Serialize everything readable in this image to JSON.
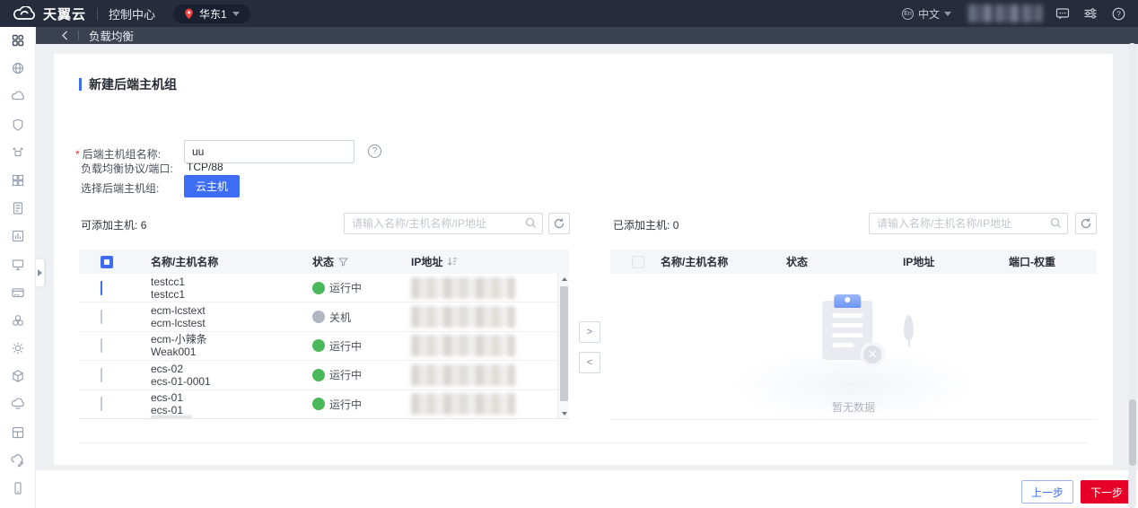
{
  "topbar": {
    "brand": "天翼云",
    "console": "控制中心",
    "region": "华东1",
    "language": "中文",
    "language_badge": "En"
  },
  "breadcrumb": {
    "title": "负载均衡"
  },
  "section": {
    "title": "新建后端主机组"
  },
  "form": {
    "protocol_label": "负载均衡协议/端口:",
    "protocol_value": "TCP/88",
    "required_mark": "*",
    "name_label": "后端主机组名称:",
    "name_value": "uu",
    "help_glyph": "?",
    "select_label": "选择后端主机组:",
    "host_type_button": "云主机"
  },
  "left_panel": {
    "count_label": "可添加主机:",
    "count": "6",
    "search_placeholder": "请输入名称/主机名称/IP地址",
    "columns": {
      "name": "名称/主机名称",
      "status": "状态",
      "ip": "IP地址"
    },
    "rows": [
      {
        "name": "testcc1",
        "host": "testcc1",
        "status": "运行中",
        "status_type": "running",
        "checked": true
      },
      {
        "name": "ecm-lcstext",
        "host": "ecm-lcstest",
        "status": "关机",
        "status_type": "stopped",
        "checked": false
      },
      {
        "name": "ecm-小辣条",
        "host": "Weak001",
        "status": "运行中",
        "status_type": "running",
        "checked": false
      },
      {
        "name": "ecs-02",
        "host": "ecs-01-0001",
        "status": "运行中",
        "status_type": "running",
        "checked": false
      },
      {
        "name": "ecs-01",
        "host": "ecs-01",
        "status": "运行中",
        "status_type": "running",
        "checked": false
      }
    ]
  },
  "right_panel": {
    "count_label": "已添加主机:",
    "count": "0",
    "search_placeholder": "请输入名称/主机名称/IP地址",
    "columns": {
      "name": "名称/主机名称",
      "status": "状态",
      "ip": "IP地址",
      "port_weight": "端口-权重"
    },
    "empty_text": "暂无数据"
  },
  "transfer": {
    "to_right": ">",
    "to_left": "<"
  },
  "footer": {
    "prev": "上一步",
    "next": "下一步"
  },
  "sidebar": {
    "items": [
      "dashboard",
      "network",
      "cloud-server",
      "security-shield",
      "iot-device",
      "app-grid",
      "document",
      "bar-chart",
      "monitor",
      "billing-card",
      "service-circles",
      "settings-sun",
      "cube",
      "cloud-storage",
      "layout-grid",
      "cloud-edit",
      "mobile-device"
    ]
  },
  "colors": {
    "accent_blue": "#3d6df2",
    "danger_red": "#e60027",
    "running_green": "#4cb85c",
    "stopped_gray": "#b0b7c3",
    "topbar_dark": "#262c3c",
    "breadcrumb_dark": "#3a4151"
  }
}
